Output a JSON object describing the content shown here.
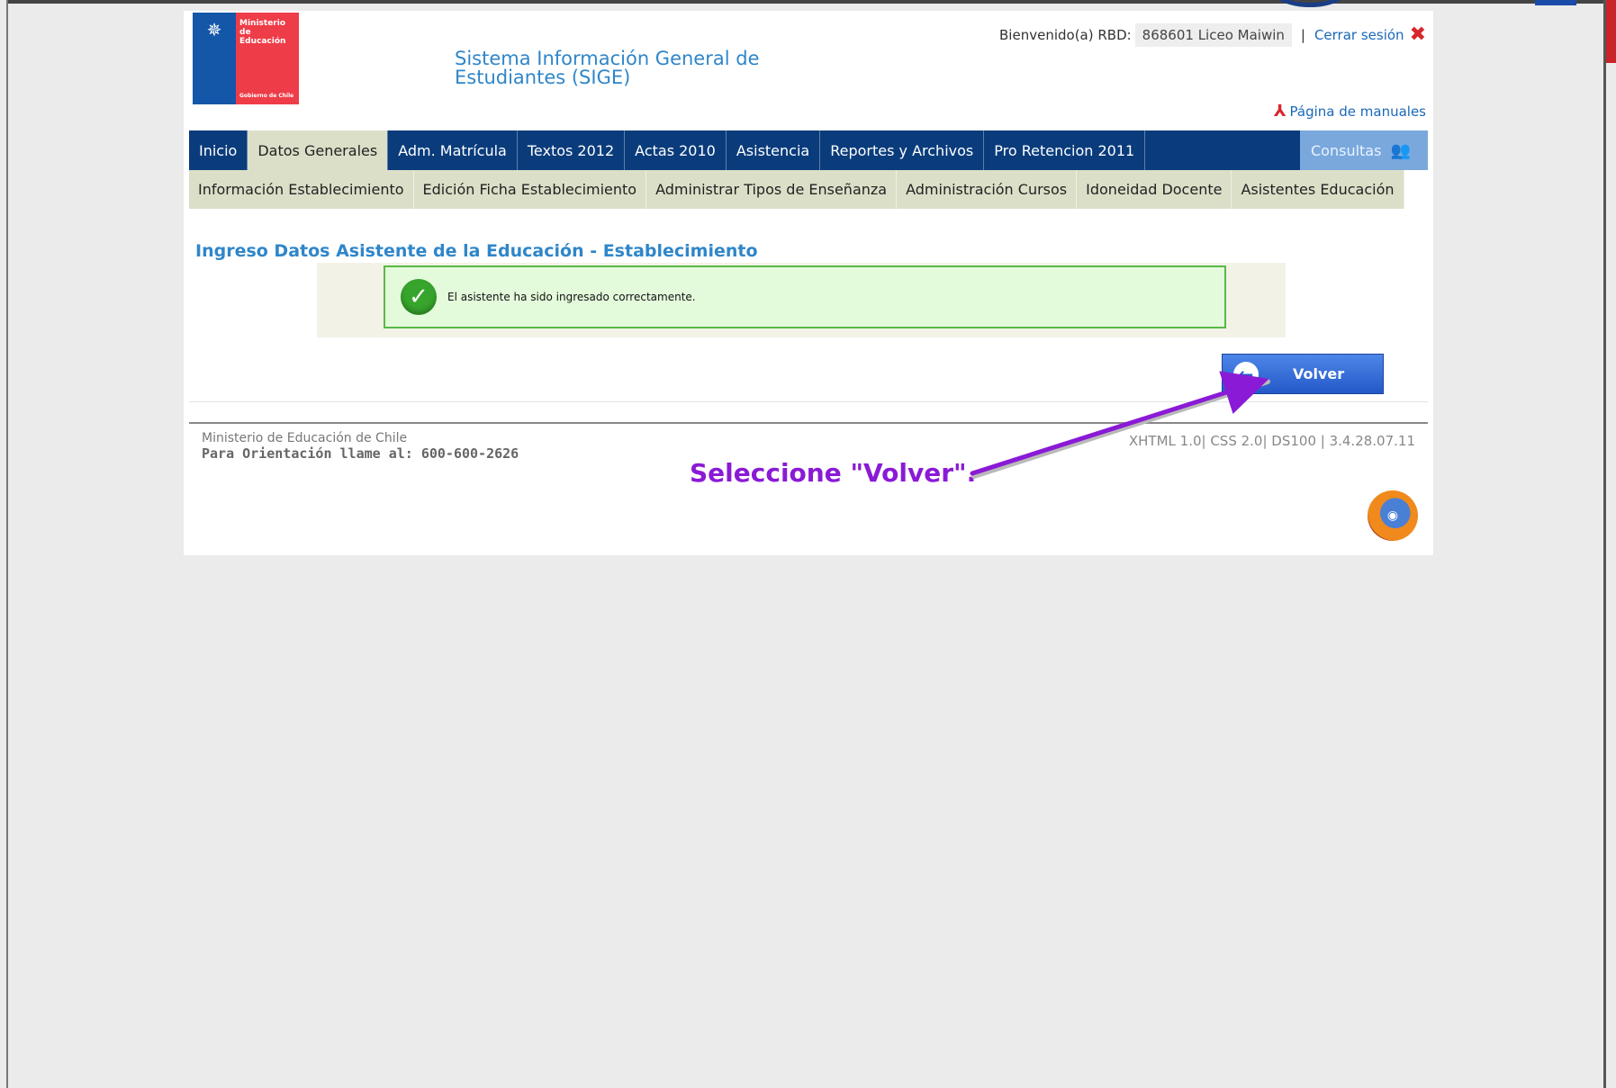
{
  "header": {
    "logo_line1": "Ministerio de Educación",
    "logo_line2": "Gobierno de Chile",
    "system_title": "Sistema Información General de Estudiantes (SIGE)",
    "welcome_label": "Bienvenido(a) RBD:",
    "rbd_value": "868601  Liceo Maiwin",
    "separator": "|",
    "logout_label": "Cerrar sesión",
    "manuals_label": "Página de manuales"
  },
  "nav": {
    "items": [
      {
        "label": "Inicio"
      },
      {
        "label": "Datos Generales"
      },
      {
        "label": "Adm. Matrícula"
      },
      {
        "label": "Textos 2012"
      },
      {
        "label": "Actas 2010"
      },
      {
        "label": "Asistencia"
      },
      {
        "label": "Reportes y Archivos"
      },
      {
        "label": "Pro Retencion 2011"
      }
    ],
    "consultas_label": "Consultas"
  },
  "subnav": {
    "items": [
      {
        "label": "Información Establecimiento"
      },
      {
        "label": "Edición Ficha Establecimiento"
      },
      {
        "label": "Administrar Tipos de Enseñanza"
      },
      {
        "label": "Administración Cursos"
      },
      {
        "label": "Idoneidad Docente"
      },
      {
        "label": "Asistentes Educación"
      }
    ]
  },
  "main": {
    "page_title": "Ingreso Datos Asistente de la Educación - Establecimiento",
    "success_message": "El asistente ha sido ingresado correctamente.",
    "back_button_label": "Volver"
  },
  "footer": {
    "ministry": "Ministerio de Educación de Chile",
    "phone_line": "Para Orientación llame al: 600-600-2626",
    "tech_info": "XHTML 1.0| CSS 2.0| DS100 | 3.4.28.07.11"
  },
  "annotation": {
    "text": "Seleccione \"Volver\"."
  },
  "colors": {
    "nav_bg": "#0a3c7c",
    "subnav_bg": "#dcdfc8",
    "title_blue": "#2f86c9",
    "success_green": "#58b948",
    "annotation_purple": "#8a1ad6"
  },
  "icons": {
    "close": "close-icon",
    "pdf": "pdf-icon",
    "people": "people-icon",
    "check": "check-icon",
    "back": "back-arrow-icon",
    "browser": "firefox-icon"
  }
}
